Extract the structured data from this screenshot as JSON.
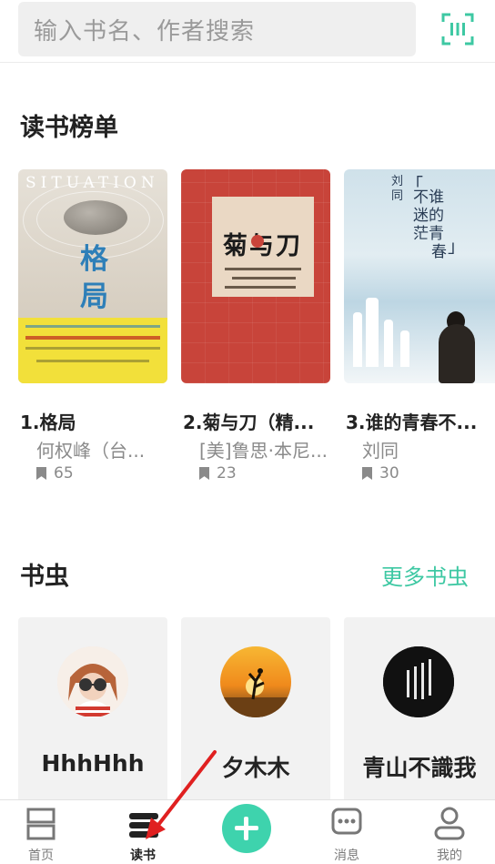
{
  "search": {
    "placeholder": "输入书名、作者搜索",
    "scan_icon": "scan-icon"
  },
  "ranking": {
    "title": "读书榜单",
    "books": [
      {
        "title": "1.格局",
        "author": "何权峰（台...",
        "count": "65",
        "cover": {
          "brand": "SITUATION",
          "big_chars": [
            "格",
            "局"
          ]
        }
      },
      {
        "title": "2.菊与刀（精...",
        "author": "[美]鲁思·本尼...",
        "count": "23",
        "cover": {
          "big_text": "菊与刀"
        }
      },
      {
        "title": "3.谁的青春不...",
        "author": "刘同",
        "count": "30",
        "cover": {
          "author": "刘同",
          "bracket_open": "「",
          "bracket_close": "」",
          "lines": [
            "不谁",
            "迷的",
            "茫青",
            "春"
          ]
        }
      }
    ]
  },
  "bookworms": {
    "title": "书虫",
    "more": "更多书虫",
    "users": [
      {
        "name": "HhhHhh"
      },
      {
        "name": "夕木木"
      },
      {
        "name": "青山不識我"
      }
    ]
  },
  "tabs": [
    {
      "label": "首页",
      "icon": "home-icon",
      "active": false
    },
    {
      "label": "读书",
      "icon": "books-icon",
      "active": true
    },
    {
      "label": "",
      "icon": "plus-icon",
      "active": false
    },
    {
      "label": "消息",
      "icon": "message-icon",
      "active": false
    },
    {
      "label": "我的",
      "icon": "person-icon",
      "active": false
    }
  ],
  "colors": {
    "accent": "#3ec8a3",
    "plus": "#3ed3ad",
    "annotation": "#e02020"
  }
}
